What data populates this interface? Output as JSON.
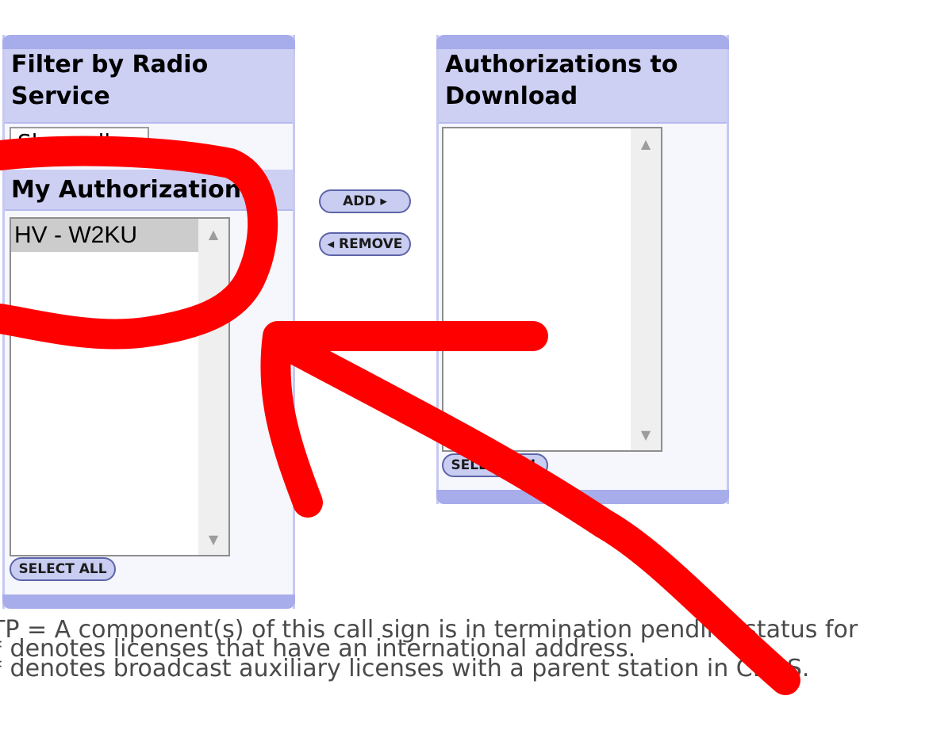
{
  "filter_panel": {
    "title": "Filter by Radio Service",
    "select_value": "Show all"
  },
  "my_authorizations": {
    "title": "My Authorizations",
    "items": [
      "HV - W2KU"
    ],
    "select_all_label": "SELECT ALL"
  },
  "actions": {
    "add_label": "ADD",
    "remove_label": "REMOVE"
  },
  "download_panel": {
    "title": "Authorizations to Download",
    "select_all_label": "SELECT ALL"
  },
  "footnotes": [
    "TP = A component(s) of this call sign is in termination pending status for",
    "* denotes licenses that have an international address.",
    "* denotes broadcast auxiliary licenses with a parent station in CDBS."
  ],
  "annotation": {
    "color": "#ff0000",
    "shapes": [
      "circle",
      "arrow"
    ]
  }
}
